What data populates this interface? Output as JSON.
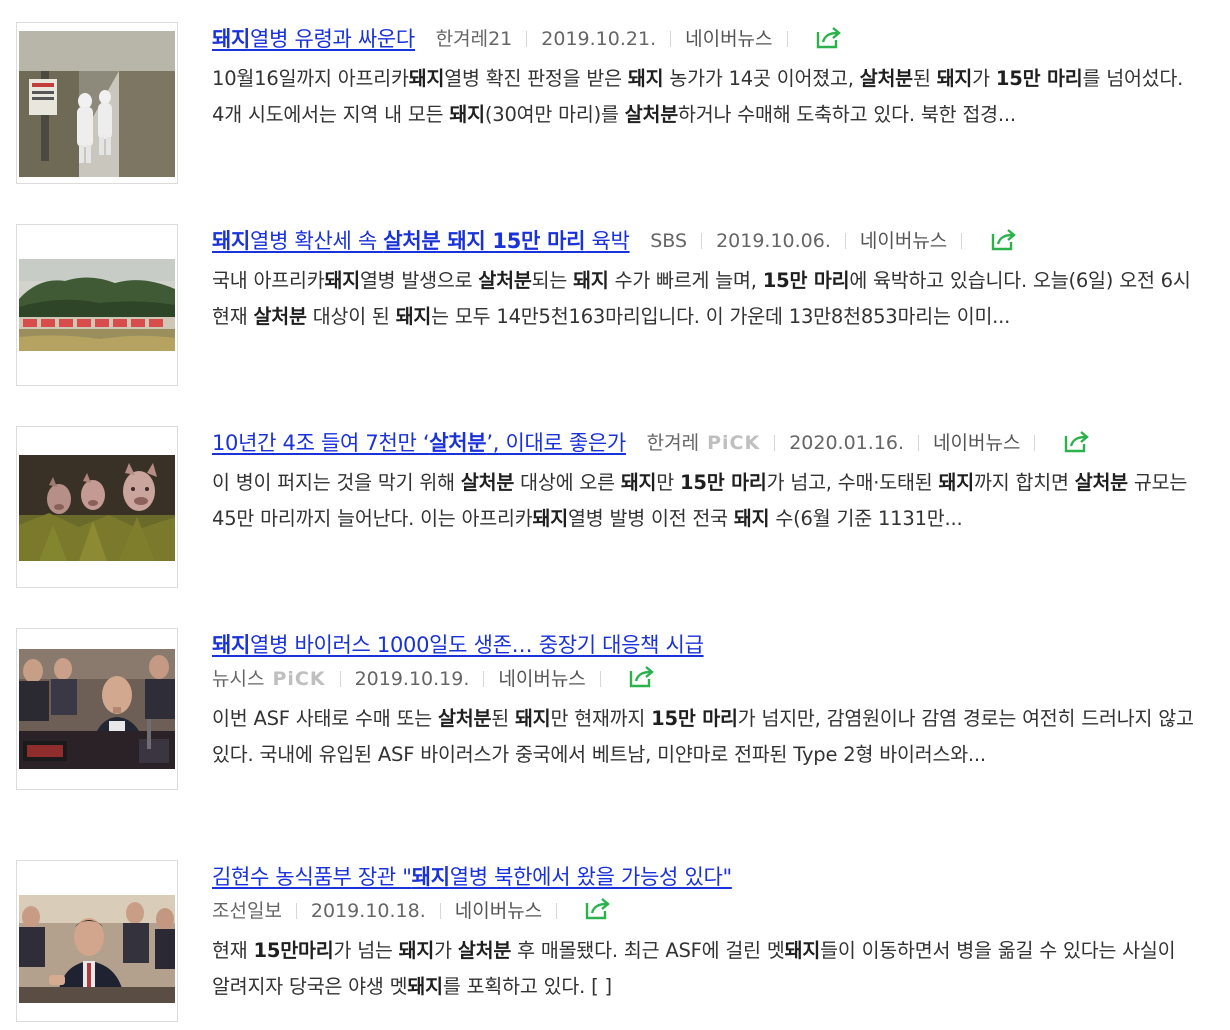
{
  "articles": [
    {
      "title_parts": [
        {
          "t": "돼지",
          "b": true
        },
        {
          "t": "열병 유령과 싸운다",
          "b": false
        }
      ],
      "source": "한겨레21",
      "pick": "",
      "date": "2019.10.21.",
      "naver": "네이버뉴스",
      "desc": [
        {
          "t": "10월16일까지 아프리카",
          "b": false
        },
        {
          "t": "돼지",
          "b": true
        },
        {
          "t": "열병 확진 판정을 받은 ",
          "b": false
        },
        {
          "t": "돼지",
          "b": true
        },
        {
          "t": " 농가가 14곳 이어졌고, ",
          "b": false
        },
        {
          "t": "살처분",
          "b": true
        },
        {
          "t": "된 ",
          "b": false
        },
        {
          "t": "돼지",
          "b": true
        },
        {
          "t": "가 ",
          "b": false
        },
        {
          "t": "15만 마리",
          "b": true
        },
        {
          "t": "를 넘어섰다. 4개 시도에서는 지역 내 모든 ",
          "b": false
        },
        {
          "t": "돼지",
          "b": true
        },
        {
          "t": "(30여만 마리)를 ",
          "b": false
        },
        {
          "t": "살처분",
          "b": true
        },
        {
          "t": "하거나 수매해 도축하고 있다. 북한 접경...",
          "b": false
        }
      ]
    },
    {
      "title_parts": [
        {
          "t": "돼지",
          "b": true
        },
        {
          "t": "열병 확산세 속 ",
          "b": false
        },
        {
          "t": "살처분 돼지 15만 마리",
          "b": true
        },
        {
          "t": " 육박",
          "b": false
        }
      ],
      "source": "SBS",
      "pick": "",
      "date": "2019.10.06.",
      "naver": "네이버뉴스",
      "desc": [
        {
          "t": "국내 아프리카",
          "b": false
        },
        {
          "t": "돼지",
          "b": true
        },
        {
          "t": "열병 발생으로 ",
          "b": false
        },
        {
          "t": "살처분",
          "b": true
        },
        {
          "t": "되는 ",
          "b": false
        },
        {
          "t": "돼지",
          "b": true
        },
        {
          "t": " 수가 빠르게 늘며, ",
          "b": false
        },
        {
          "t": "15만 마리",
          "b": true
        },
        {
          "t": "에 육박하고 있습니다. 오늘(6일) 오전 6시 현재 ",
          "b": false
        },
        {
          "t": "살처분",
          "b": true
        },
        {
          "t": " 대상이 된 ",
          "b": false
        },
        {
          "t": "돼지",
          "b": true
        },
        {
          "t": "는 모두 14만5천163마리입니다. 이 가운데 13만8천853마리는 이미...",
          "b": false
        }
      ]
    },
    {
      "title_parts": [
        {
          "t": "10년간 4조 들여 7천만 ‘",
          "b": false
        },
        {
          "t": "살처분",
          "b": true
        },
        {
          "t": "’, 이대로 좋은가",
          "b": false
        }
      ],
      "source": "한겨레",
      "pick": "PiCK",
      "date": "2020.01.16.",
      "naver": "네이버뉴스",
      "desc": [
        {
          "t": "이 병이 퍼지는 것을 막기 위해 ",
          "b": false
        },
        {
          "t": "살처분",
          "b": true
        },
        {
          "t": " 대상에 오른 ",
          "b": false
        },
        {
          "t": "돼지",
          "b": true
        },
        {
          "t": "만 ",
          "b": false
        },
        {
          "t": "15만 마리",
          "b": true
        },
        {
          "t": "가 넘고, 수매·도태된 ",
          "b": false
        },
        {
          "t": "돼지",
          "b": true
        },
        {
          "t": "까지 합치면 ",
          "b": false
        },
        {
          "t": "살처분",
          "b": true
        },
        {
          "t": " 규모는 45만 마리까지 늘어난다. 이는 아프리카",
          "b": false
        },
        {
          "t": "돼지",
          "b": true
        },
        {
          "t": "열병 발병 이전 전국 ",
          "b": false
        },
        {
          "t": "돼지",
          "b": true
        },
        {
          "t": " 수(6월 기준 1131만...",
          "b": false
        }
      ]
    },
    {
      "title_parts": [
        {
          "t": "돼지",
          "b": true
        },
        {
          "t": "열병 바이러스 1000일도 생존… 중장기 대응책 시급",
          "b": false
        }
      ],
      "source": "뉴시스",
      "pick": "PiCK",
      "date": "2019.10.19.",
      "naver": "네이버뉴스",
      "desc": [
        {
          "t": "이번 ASF 사태로 수매 또는 ",
          "b": false
        },
        {
          "t": "살처분",
          "b": true
        },
        {
          "t": "된 ",
          "b": false
        },
        {
          "t": "돼지",
          "b": true
        },
        {
          "t": "만 현재까지 ",
          "b": false
        },
        {
          "t": "15만 마리",
          "b": true
        },
        {
          "t": "가 넘지만, 감염원이나 감염 경로는 여전히 드러나지 않고 있다. 국내에 유입된 ASF 바이러스가 중국에서 베트남, 미얀마로 전파된 Type 2형 바이러스와...",
          "b": false
        }
      ]
    },
    {
      "title_parts": [
        {
          "t": "김현수 농식품부 장관 \"",
          "b": false
        },
        {
          "t": "돼지",
          "b": true
        },
        {
          "t": "열병 북한에서 왔을 가능성 있다\"",
          "b": false
        }
      ],
      "source": "조선일보",
      "pick": "",
      "date": "2019.10.18.",
      "naver": "네이버뉴스",
      "desc": [
        {
          "t": "현재 ",
          "b": false
        },
        {
          "t": "15만마리",
          "b": true
        },
        {
          "t": "가 넘는 ",
          "b": false
        },
        {
          "t": "돼지",
          "b": true
        },
        {
          "t": "가 ",
          "b": false
        },
        {
          "t": "살처분",
          "b": true
        },
        {
          "t": " 후 매몰됐다. 최근 ASF에 걸린 멧",
          "b": false
        },
        {
          "t": "돼지",
          "b": true
        },
        {
          "t": "들이 이동하면서 병을 옮길 수 있다는 사실이 알려지자 당국은 야생 멧",
          "b": false
        },
        {
          "t": "돼지",
          "b": true
        },
        {
          "t": "를 포획하고 있다. [ ]",
          "b": false
        }
      ]
    }
  ],
  "colors": {
    "title_link": "#1a32d9",
    "share_icon": "#2bb24c",
    "pick": "#bfbfbf"
  },
  "icons": {
    "share": "share-icon"
  }
}
